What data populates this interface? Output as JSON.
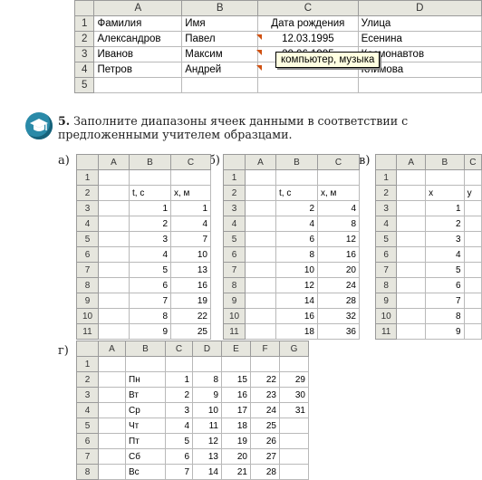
{
  "top_sheet": {
    "col_headers": [
      "",
      "A",
      "B",
      "C",
      "D"
    ],
    "rows": [
      {
        "n": "1",
        "cells": [
          "Фамилия",
          "Имя",
          "Дата рождения",
          "Улица"
        ]
      },
      {
        "n": "2",
        "cells": [
          "Александров",
          "Павел",
          "12.03.1995",
          "Есенина"
        ]
      },
      {
        "n": "3",
        "cells": [
          "Иванов",
          "Максим",
          "20.06.1995",
          "Космонавтов"
        ]
      },
      {
        "n": "4",
        "cells": [
          "Петров",
          "Андрей",
          "",
          "Климова"
        ]
      },
      {
        "n": "5",
        "cells": [
          "",
          "",
          "",
          ""
        ]
      }
    ],
    "comment": "компьютер, музыка"
  },
  "task": {
    "number": "5.",
    "text": "Заполните диапазоны ячеек данными в соответствии с предложенными учителем образцами."
  },
  "sheets": {
    "a": {
      "label": "а)",
      "col_headers": [
        "",
        "A",
        "B",
        "C"
      ],
      "rows": [
        {
          "n": "1",
          "cells": [
            "",
            "",
            ""
          ]
        },
        {
          "n": "2",
          "cells": [
            "",
            "t, c",
            "x, м"
          ]
        },
        {
          "n": "3",
          "cells": [
            "",
            "1",
            "1"
          ]
        },
        {
          "n": "4",
          "cells": [
            "",
            "2",
            "4"
          ]
        },
        {
          "n": "5",
          "cells": [
            "",
            "3",
            "7"
          ]
        },
        {
          "n": "6",
          "cells": [
            "",
            "4",
            "10"
          ]
        },
        {
          "n": "7",
          "cells": [
            "",
            "5",
            "13"
          ]
        },
        {
          "n": "8",
          "cells": [
            "",
            "6",
            "16"
          ]
        },
        {
          "n": "9",
          "cells": [
            "",
            "7",
            "19"
          ]
        },
        {
          "n": "10",
          "cells": [
            "",
            "8",
            "22"
          ]
        },
        {
          "n": "11",
          "cells": [
            "",
            "9",
            "25"
          ]
        }
      ]
    },
    "b": {
      "label": "б)",
      "col_headers": [
        "",
        "A",
        "B",
        "C"
      ],
      "rows": [
        {
          "n": "1",
          "cells": [
            "",
            "",
            ""
          ]
        },
        {
          "n": "2",
          "cells": [
            "",
            "t, c",
            "x, м"
          ]
        },
        {
          "n": "3",
          "cells": [
            "",
            "2",
            "4"
          ]
        },
        {
          "n": "4",
          "cells": [
            "",
            "4",
            "8"
          ]
        },
        {
          "n": "5",
          "cells": [
            "",
            "6",
            "12"
          ]
        },
        {
          "n": "6",
          "cells": [
            "",
            "8",
            "16"
          ]
        },
        {
          "n": "7",
          "cells": [
            "",
            "10",
            "20"
          ]
        },
        {
          "n": "8",
          "cells": [
            "",
            "12",
            "24"
          ]
        },
        {
          "n": "9",
          "cells": [
            "",
            "14",
            "28"
          ]
        },
        {
          "n": "10",
          "cells": [
            "",
            "16",
            "32"
          ]
        },
        {
          "n": "11",
          "cells": [
            "",
            "18",
            "36"
          ]
        }
      ]
    },
    "c": {
      "label": "в)",
      "col_headers": [
        "",
        "A",
        "B",
        "C"
      ],
      "rows": [
        {
          "n": "1",
          "cells": [
            "",
            "",
            ""
          ]
        },
        {
          "n": "2",
          "cells": [
            "",
            "x",
            "y"
          ]
        },
        {
          "n": "3",
          "cells": [
            "",
            "1",
            ""
          ]
        },
        {
          "n": "4",
          "cells": [
            "",
            "2",
            ""
          ]
        },
        {
          "n": "5",
          "cells": [
            "",
            "3",
            ""
          ]
        },
        {
          "n": "6",
          "cells": [
            "",
            "4",
            ""
          ]
        },
        {
          "n": "7",
          "cells": [
            "",
            "5",
            ""
          ]
        },
        {
          "n": "8",
          "cells": [
            "",
            "6",
            ""
          ]
        },
        {
          "n": "9",
          "cells": [
            "",
            "7",
            ""
          ]
        },
        {
          "n": "10",
          "cells": [
            "",
            "8",
            ""
          ]
        },
        {
          "n": "11",
          "cells": [
            "",
            "9",
            ""
          ]
        }
      ]
    },
    "d": {
      "label": "г)",
      "col_headers": [
        "",
        "A",
        "B",
        "C",
        "D",
        "E",
        "F",
        "G"
      ],
      "rows": [
        {
          "n": "1",
          "cells": [
            "",
            "",
            "",
            "",
            "",
            "",
            ""
          ]
        },
        {
          "n": "2",
          "cells": [
            "",
            "Пн",
            "1",
            "8",
            "15",
            "22",
            "29"
          ]
        },
        {
          "n": "3",
          "cells": [
            "",
            "Вт",
            "2",
            "9",
            "16",
            "23",
            "30"
          ]
        },
        {
          "n": "4",
          "cells": [
            "",
            "Ср",
            "3",
            "10",
            "17",
            "24",
            "31"
          ]
        },
        {
          "n": "5",
          "cells": [
            "",
            "Чт",
            "4",
            "11",
            "18",
            "25",
            ""
          ]
        },
        {
          "n": "6",
          "cells": [
            "",
            "Пт",
            "5",
            "12",
            "19",
            "26",
            ""
          ]
        },
        {
          "n": "7",
          "cells": [
            "",
            "Сб",
            "6",
            "13",
            "20",
            "27",
            ""
          ]
        },
        {
          "n": "8",
          "cells": [
            "",
            "Вс",
            "7",
            "14",
            "21",
            "28",
            ""
          ]
        }
      ]
    }
  }
}
